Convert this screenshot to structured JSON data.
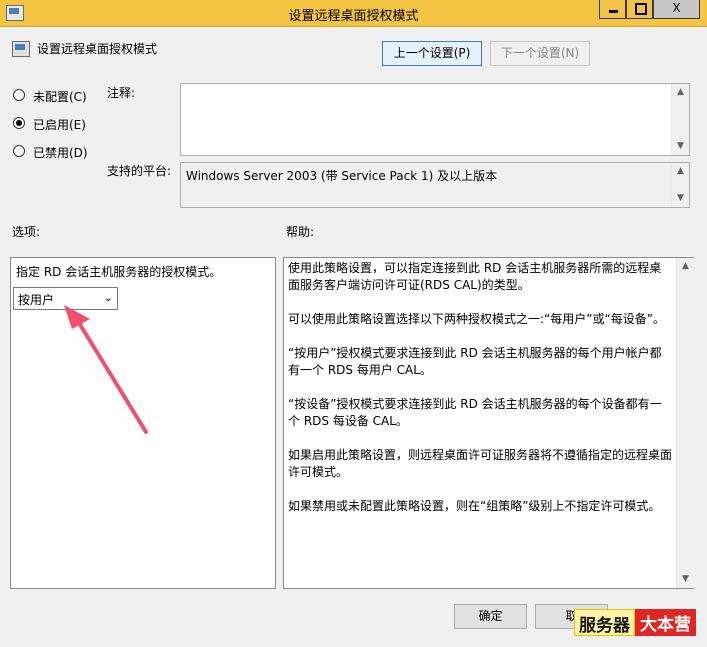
{
  "window": {
    "title": "设置远程桌面授权模式",
    "min_symbol": "",
    "max_symbol": "",
    "close_symbol": "X"
  },
  "header": {
    "title": "设置远程桌面授权模式",
    "prev_button": "上一个设置(P)",
    "next_button": "下一个设置(N)"
  },
  "state": {
    "options": [
      {
        "label": "未配置(C)",
        "selected": false
      },
      {
        "label": "已启用(E)",
        "selected": true
      },
      {
        "label": "已禁用(D)",
        "selected": false
      }
    ]
  },
  "comment": {
    "label": "注释:",
    "value": ""
  },
  "platform": {
    "label": "支持的平台:",
    "value": "Windows Server 2003 (带 Service Pack 1) 及以上版本"
  },
  "options_section": {
    "heading": "选项:",
    "description": "指定 RD 会话主机服务器的授权模式。",
    "select_value": "按用户"
  },
  "help_section": {
    "heading": "帮助:",
    "paragraphs": [
      "使用此策略设置，可以指定连接到此 RD 会话主机服务器所需的远程桌面服务客户端访问许可证(RDS CAL)的类型。",
      "可以使用此策略设置选择以下两种授权模式之一:“每用户”或“每设备”。",
      "“按用户”授权模式要求连接到此 RD 会话主机服务器的每个用户帐户都有一个 RDS 每用户 CAL。",
      "“按设备”授权模式要求连接到此 RD 会话主机服务器的每个设备都有一个 RDS 每设备 CAL。",
      "如果启用此策略设置，则远程桌面许可证服务器将不遵循指定的远程桌面许可模式。",
      "如果禁用或未配置此策略设置，则在“组策略”级别上不指定许可模式。"
    ]
  },
  "footer": {
    "ok_button": "确定",
    "cancel_button": "取"
  },
  "watermark": {
    "part1": "服务器",
    "part2": "大本营"
  },
  "colors": {
    "titlebar": "#f4c542",
    "annotation_arrow": "#f0506e",
    "watermark_red": "#e02525"
  }
}
